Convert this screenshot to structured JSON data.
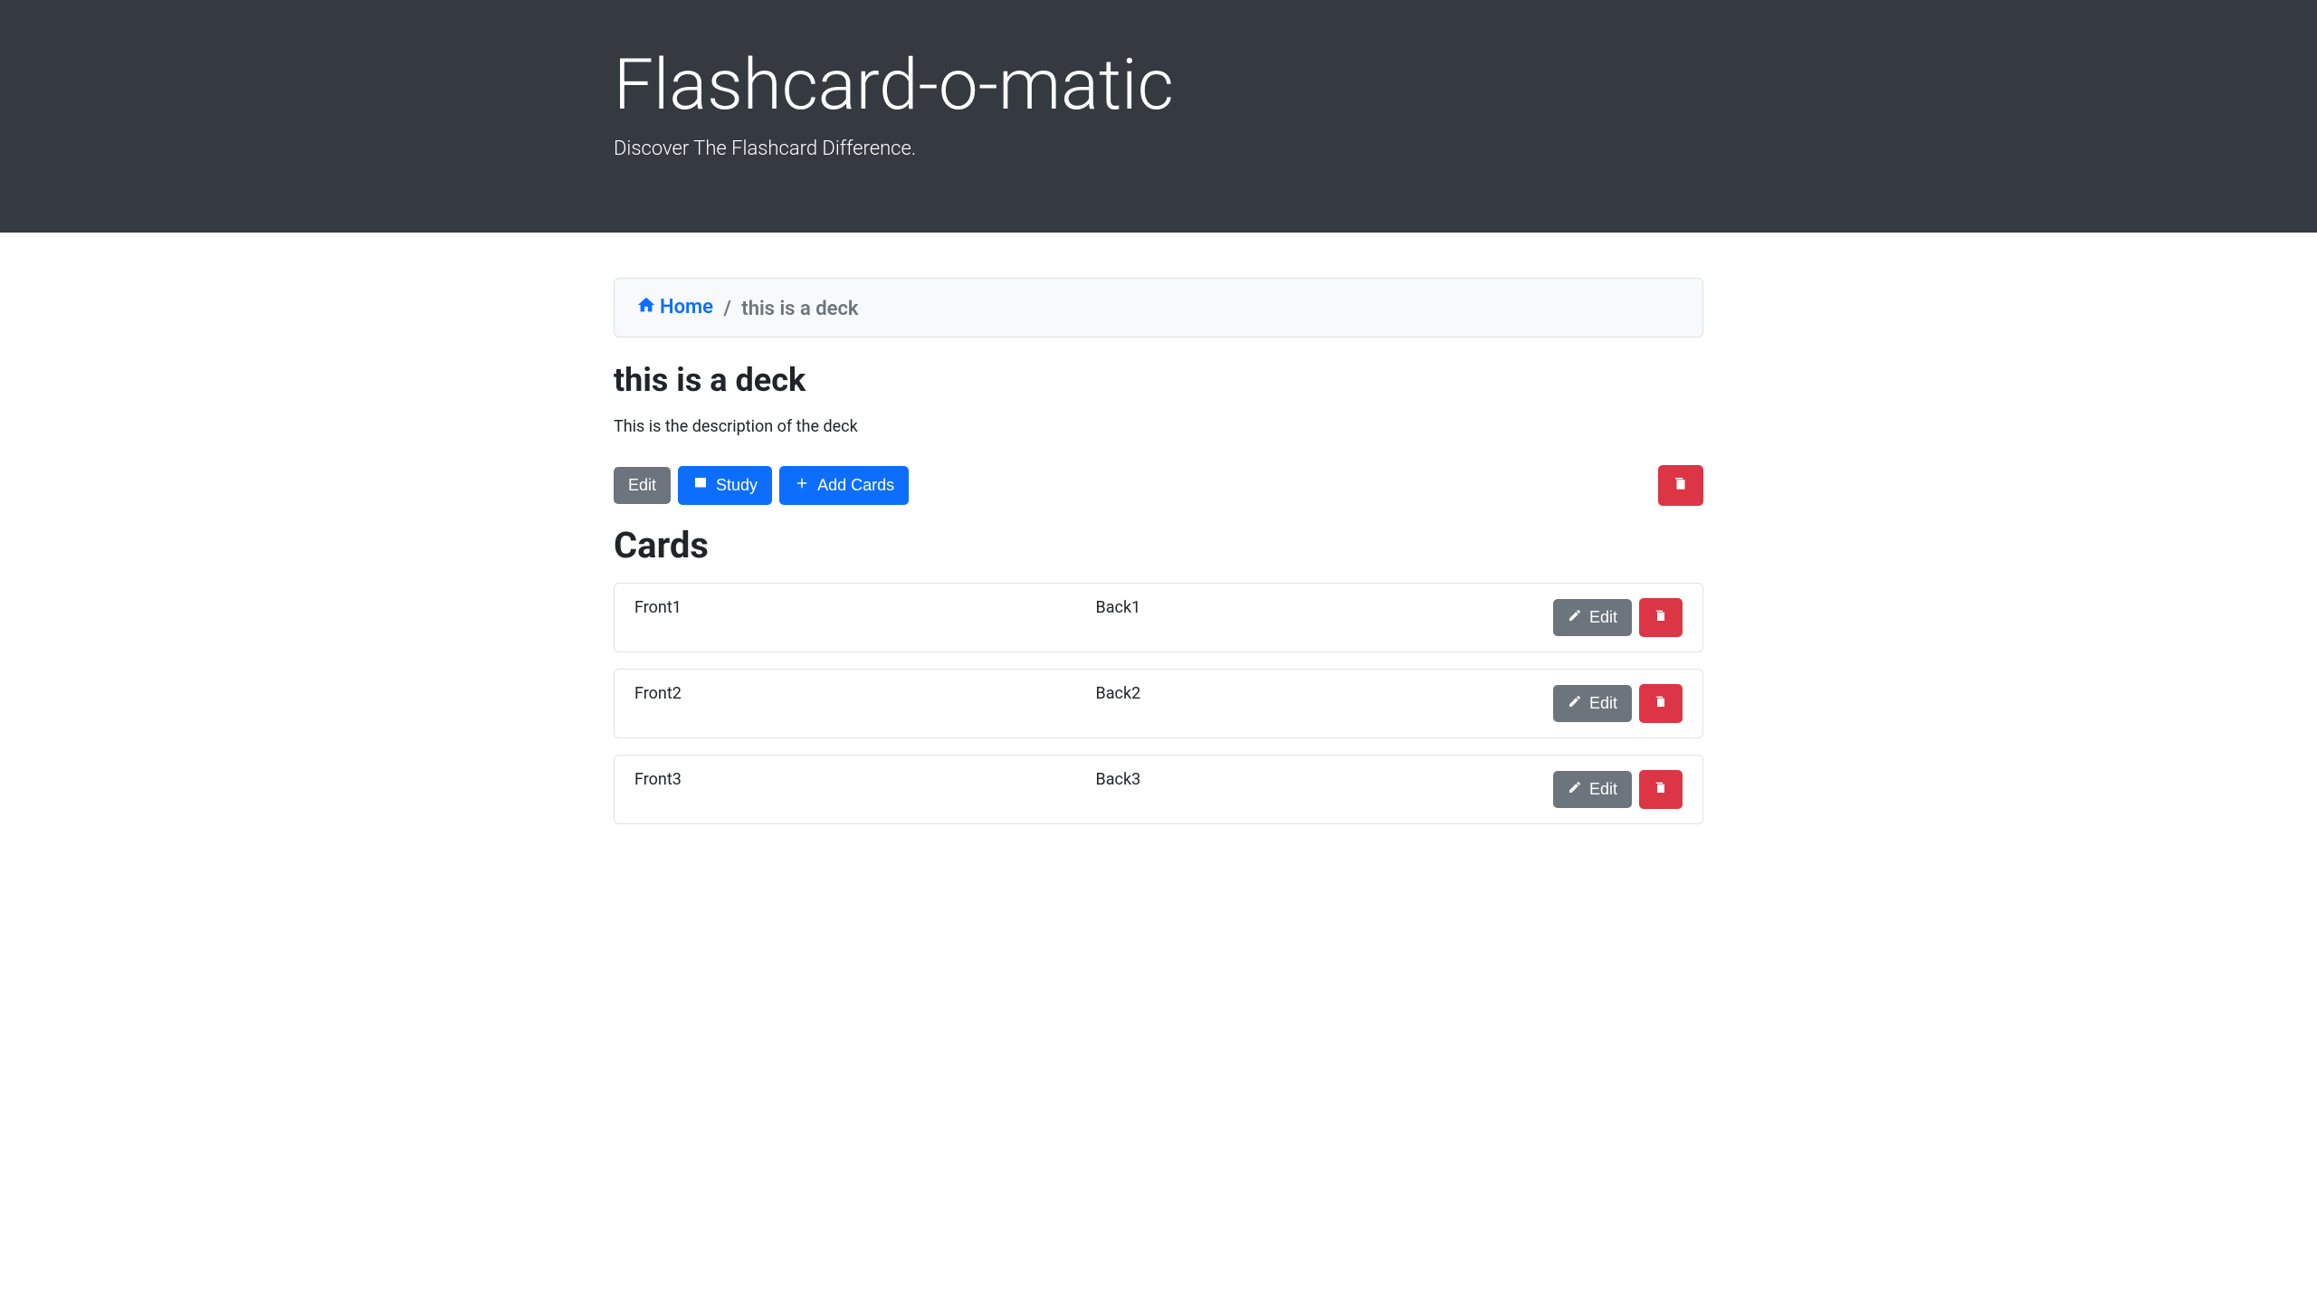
{
  "header": {
    "title": "Flashcard-o-matic",
    "subtitle": "Discover The Flashcard Difference."
  },
  "breadcrumb": {
    "home_label": "Home",
    "current": "this is a deck"
  },
  "deck": {
    "title": "this is a deck",
    "description": "This is the description of the deck"
  },
  "actions": {
    "edit_label": "Edit",
    "study_label": "Study",
    "add_cards_label": "Add Cards"
  },
  "cards_section": {
    "title": "Cards",
    "edit_label": "Edit"
  },
  "cards": [
    {
      "front": "Front1",
      "back": "Back1"
    },
    {
      "front": "Front2",
      "back": "Back2"
    },
    {
      "front": "Front3",
      "back": "Back3"
    }
  ]
}
